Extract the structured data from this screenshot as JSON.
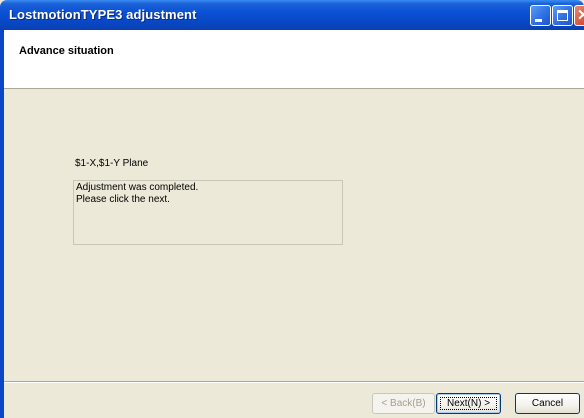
{
  "window": {
    "title": "LostmotionTYPE3 adjustment",
    "controls": {
      "minimize_icon": "minimize-icon",
      "maximize_icon": "maximize-icon",
      "close_icon": "close-icon"
    }
  },
  "header": {
    "title": "Advance situation"
  },
  "content": {
    "plane_label": "$1-X,$1-Y Plane",
    "message_lines": [
      "Adjustment was completed.",
      "Please click the next."
    ]
  },
  "buttons": {
    "back": "< Back(B)",
    "next": "Next(N) >",
    "cancel": "Cancel"
  },
  "colors": {
    "dialog_background": "#ece9d8",
    "titlebar": "#0a52d6",
    "header_background": "#ffffff"
  }
}
